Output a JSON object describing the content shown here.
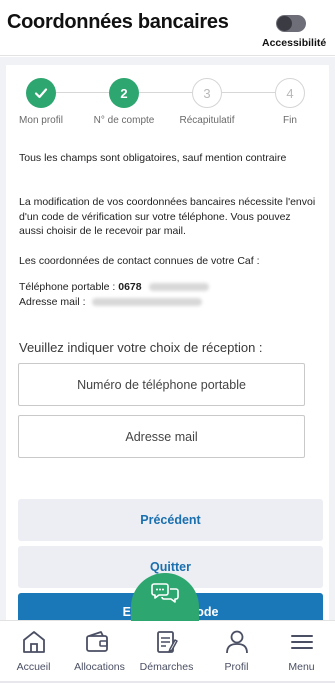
{
  "header": {
    "title": "Coordonnées bancaires",
    "accessibility_label": "Accessibilité"
  },
  "stepper": {
    "steps": [
      {
        "number": "1",
        "label": "Mon profil",
        "state": "done"
      },
      {
        "number": "2",
        "label": "N° de compte",
        "state": "current"
      },
      {
        "number": "3",
        "label": "Récapitulatif",
        "state": "todo"
      },
      {
        "number": "4",
        "label": "Fin",
        "state": "todo"
      }
    ]
  },
  "form": {
    "mandatory_note": "Tous les champs sont obligatoires, sauf mention contraire",
    "intro": "La modification de vos coordonnées bancaires nécessite l'envoi d'un code de vérification sur votre téléphone. Vous pouvez aussi choisir de le recevoir par mail.",
    "contacts_intro": "Les coordonnées de contact connues de votre Caf :",
    "phone_label": "Téléphone portable :",
    "phone_value": "0678",
    "mail_label": "Adresse mail :",
    "choice_title": "Veuillez indiquer votre choix de réception :",
    "choice_phone": "Numéro de téléphone portable",
    "choice_mail": "Adresse mail"
  },
  "actions": {
    "previous": "Précédent",
    "quit": "Quitter",
    "send_code": "Envoyer le code"
  },
  "bottom_nav": {
    "items": [
      {
        "label": "Accueil",
        "icon": "home-icon"
      },
      {
        "label": "Allocations",
        "icon": "wallet-icon"
      },
      {
        "label": "Démarches",
        "icon": "document-edit-icon"
      },
      {
        "label": "Profil",
        "icon": "user-icon"
      },
      {
        "label": "Menu",
        "icon": "menu-icon"
      }
    ]
  },
  "colors": {
    "green": "#2ea66f",
    "primary_blue": "#1b78b8",
    "link_blue": "#1a6fae"
  }
}
